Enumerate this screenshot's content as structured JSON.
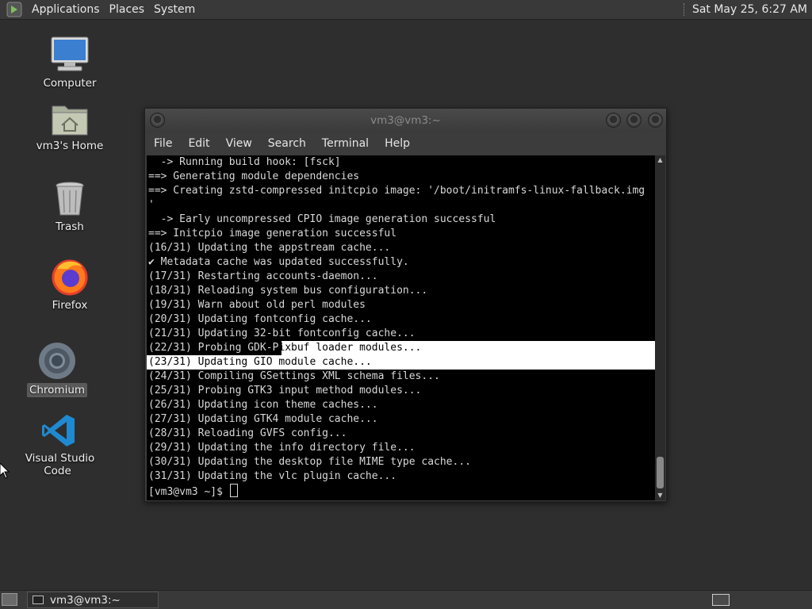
{
  "top_panel": {
    "menus": [
      "Applications",
      "Places",
      "System"
    ],
    "clock": "Sat May 25,  6:27 AM"
  },
  "desktop": {
    "icons": [
      {
        "label": "Computer",
        "icon": "computer-icon"
      },
      {
        "label": "vm3's Home",
        "icon": "home-folder-icon"
      },
      {
        "label": "Trash",
        "icon": "trash-icon"
      },
      {
        "label": "Firefox",
        "icon": "firefox-icon"
      },
      {
        "label": "Chromium",
        "icon": "chromium-icon"
      },
      {
        "label": "Visual Studio Code",
        "icon": "vscode-icon"
      }
    ]
  },
  "terminal": {
    "title": "vm3@vm3:~",
    "menu": [
      "File",
      "Edit",
      "View",
      "Search",
      "Terminal",
      "Help"
    ],
    "lines": [
      "  -> Running build hook: [fsck]",
      "==> Generating module dependencies",
      "==> Creating zstd-compressed initcpio image: '/boot/initramfs-linux-fallback.img",
      "'",
      "  -> Early uncompressed CPIO image generation successful",
      "==> Initcpio image generation successful",
      "(16/31) Updating the appstream cache...",
      "✔ Metadata cache was updated successfully.",
      "(17/31) Restarting accounts-daemon...",
      "(18/31) Reloading system bus configuration...",
      "(19/31) Warn about old perl modules",
      "(20/31) Updating fontconfig cache...",
      "(21/31) Updating 32-bit fontconfig cache...",
      "(22/31) Probing GDK-Pixbuf loader modules...",
      "(23/31) Updating GIO module cache...",
      "(24/31) Compiling GSettings XML schema files...",
      "(25/31) Probing GTK3 input method modules...",
      "(26/31) Updating icon theme caches...",
      "(27/31) Updating GTK4 module cache...",
      "(28/31) Reloading GVFS config...",
      "(29/31) Updating the info directory file...",
      "(30/31) Updating the desktop file MIME type cache...",
      "(31/31) Updating the vlc plugin cache..."
    ],
    "sel_line_a_plain": "(22/31) Probing GDK-P",
    "sel_line_a_hl": "ixbuf loader modules...",
    "prompt": "[vm3@vm3 ~]$ "
  },
  "bottom_panel": {
    "task": "vm3@vm3:~"
  }
}
